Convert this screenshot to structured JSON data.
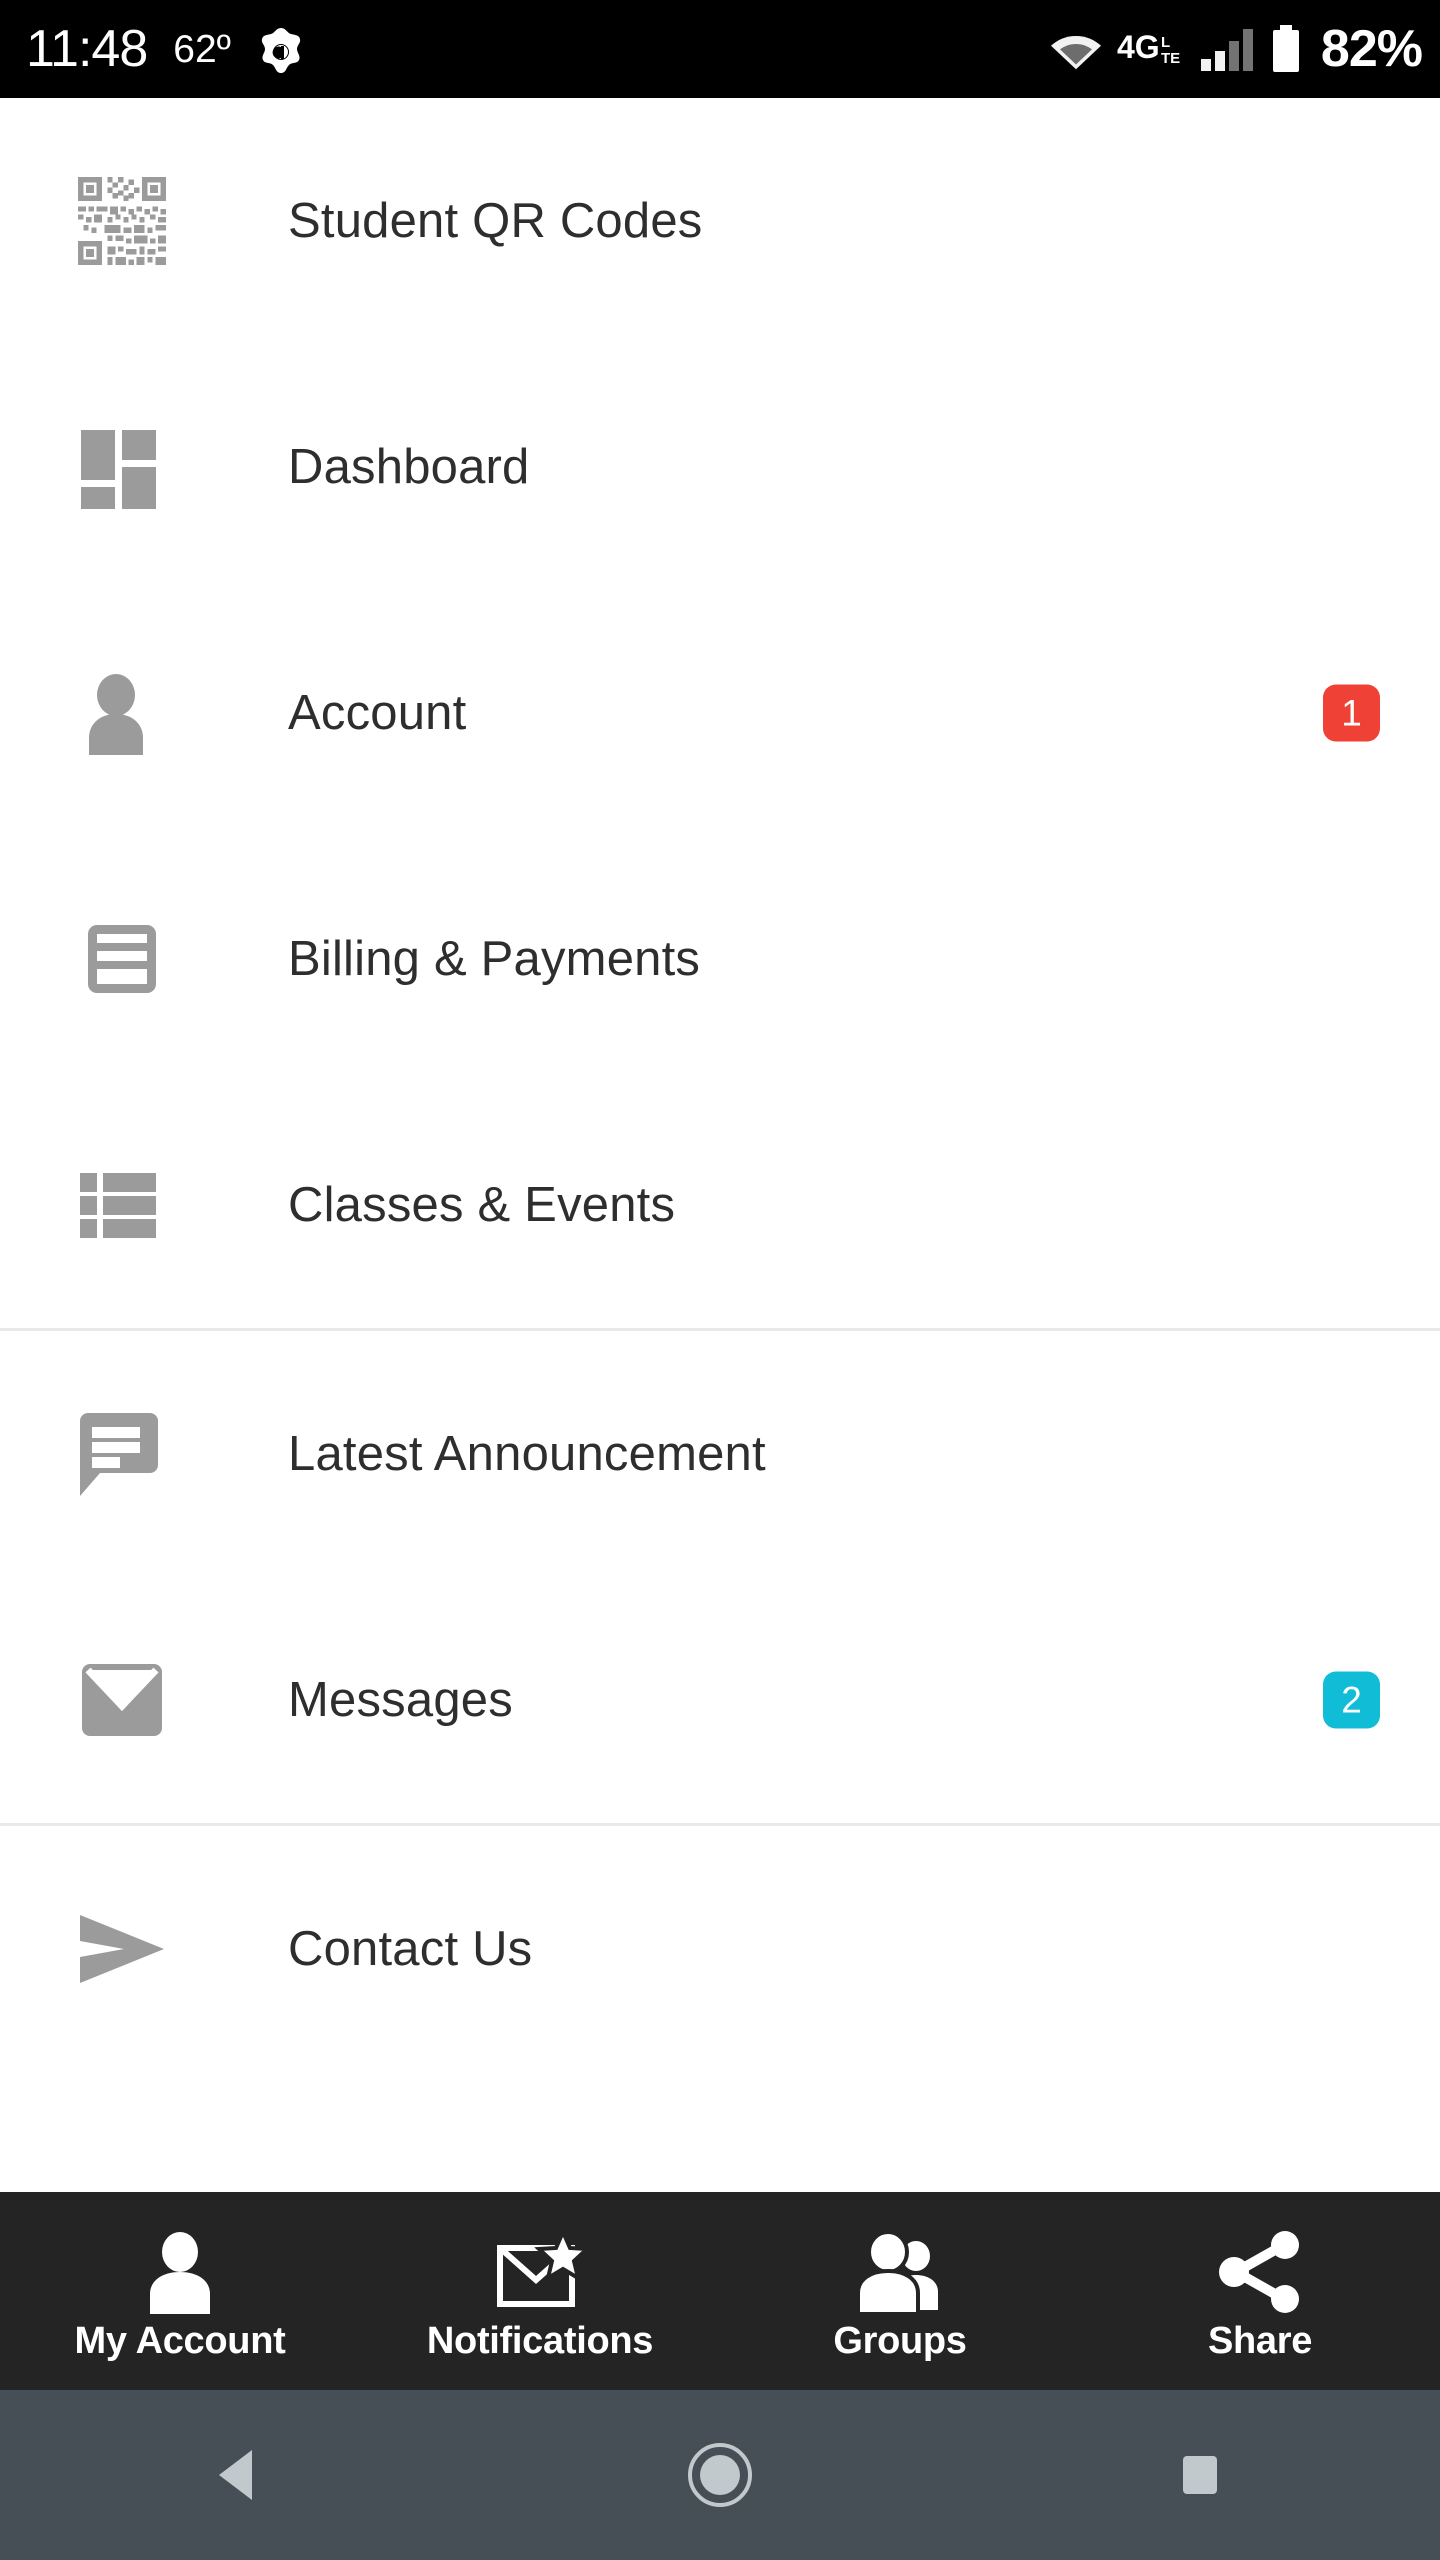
{
  "status_bar": {
    "clock": "11:48",
    "temperature": "62º",
    "app_icon": "avast-icon",
    "wifi_icon": "wifi-icon",
    "network_label": "4G",
    "network_sub": "LTE",
    "signal_icon": "signal-bars-icon",
    "battery_icon": "battery-icon",
    "battery_percent": "82%",
    "background_color": "#000000",
    "text_color": "#ffffff"
  },
  "menu": {
    "sections": [
      {
        "items": [
          {
            "label": "Student QR Codes",
            "icon": "qr-code-icon",
            "badge": null,
            "badge_color": null
          },
          {
            "label": "Dashboard",
            "icon": "dashboard-grid-icon",
            "badge": null,
            "badge_color": null
          },
          {
            "label": "Account",
            "icon": "person-icon",
            "badge": "1",
            "badge_color": "#f04136"
          },
          {
            "label": "Billing & Payments",
            "icon": "credit-card-icon",
            "badge": null,
            "badge_color": null
          },
          {
            "label": "Classes & Events",
            "icon": "list-icon",
            "badge": null,
            "badge_color": null
          }
        ]
      },
      {
        "items": [
          {
            "label": "Latest Announcement",
            "icon": "speech-bubble-icon",
            "badge": null,
            "badge_color": null
          },
          {
            "label": "Messages",
            "icon": "envelope-icon",
            "badge": "2",
            "badge_color": "#10bcd6"
          }
        ]
      },
      {
        "items": [
          {
            "label": "Contact Us",
            "icon": "paper-plane-icon",
            "badge": null,
            "badge_color": null
          }
        ]
      }
    ],
    "icon_color": "#9b9b9b",
    "label_color": "#2e2e2e",
    "divider_color": "#e8eaea"
  },
  "tab_bar": {
    "background_color": "#242424",
    "tabs": [
      {
        "label": "My Account",
        "icon": "person-icon"
      },
      {
        "label": "Notifications",
        "icon": "envelope-star-icon"
      },
      {
        "label": "Groups",
        "icon": "people-group-icon"
      },
      {
        "label": "Share",
        "icon": "share-nodes-icon"
      }
    ]
  },
  "nav_bar": {
    "background_color": "#464f55",
    "buttons": [
      {
        "name": "back",
        "icon": "triangle-back-icon"
      },
      {
        "name": "home",
        "icon": "circle-home-icon"
      },
      {
        "name": "recents",
        "icon": "square-recents-icon"
      }
    ]
  }
}
